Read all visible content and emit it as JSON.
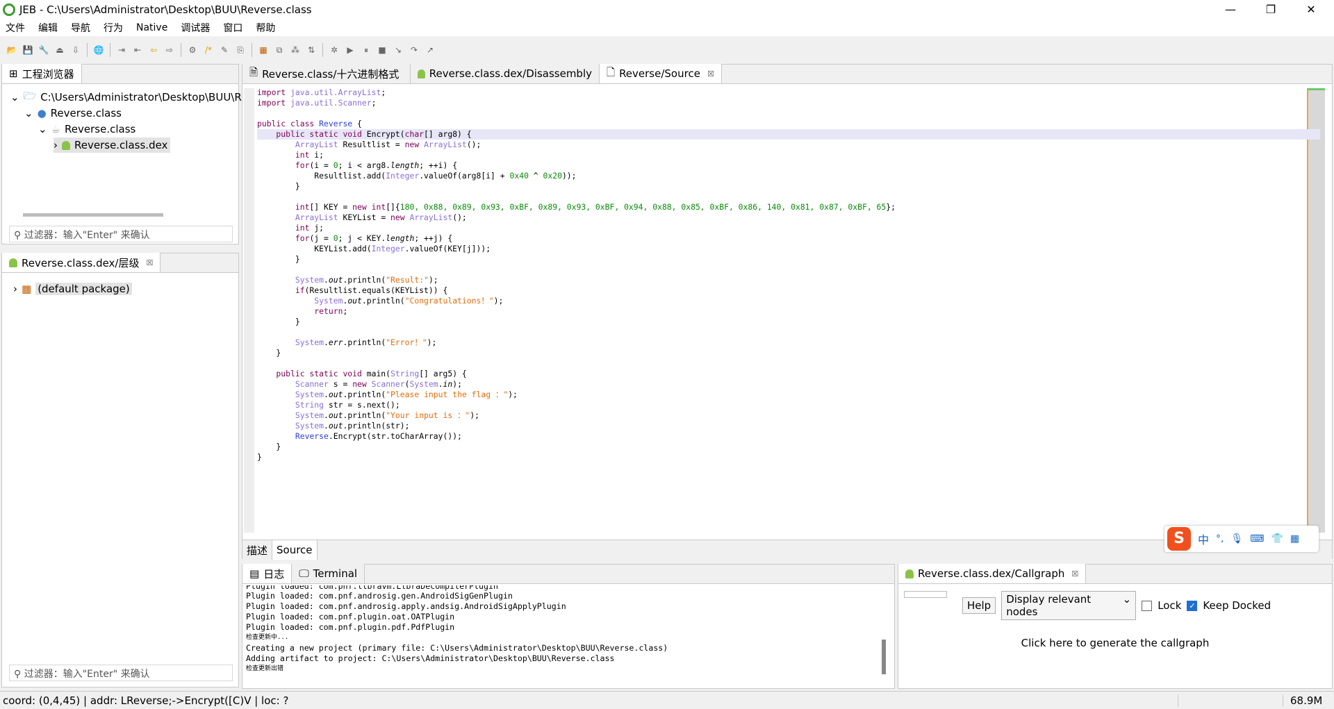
{
  "window": {
    "title": "JEB - C:\\Users\\Administrator\\Desktop\\BUU\\Reverse.class",
    "minimize": "—",
    "restore": "❐",
    "close": "✕"
  },
  "menu": [
    "文件",
    "编辑",
    "导航",
    "行为",
    "Native",
    "调试器",
    "窗口",
    "帮助"
  ],
  "project_explorer": {
    "tab": "工程浏览器",
    "items": [
      "C:\\Users\\Administrator\\Desktop\\BUU\\Reverse.class",
      "Reverse.class",
      "Reverse.class",
      "Reverse.class.dex"
    ],
    "filter_placeholder": "过滤器：输入\"Enter\" 来确认"
  },
  "hierarchy": {
    "tab": "Reverse.class.dex/层级",
    "items": [
      "(default package)"
    ],
    "filter_placeholder": "过滤器：输入\"Enter\" 来确认"
  },
  "editor": {
    "tabs": [
      "Reverse.class/十六进制格式",
      "Reverse.class.dex/Disassembly",
      "Reverse/Source"
    ],
    "bottom_tabs": [
      "描述",
      "Source"
    ],
    "code": [
      [
        [
          "import ",
          "kw"
        ],
        [
          "java.util.ArrayList",
          "ty"
        ],
        [
          ";",
          ""
        ]
      ],
      [
        [
          "import ",
          "kw"
        ],
        [
          "java.util.Scanner",
          "ty"
        ],
        [
          ";",
          ""
        ]
      ],
      [],
      [
        [
          "public class ",
          "kw"
        ],
        [
          "Reverse",
          "cls"
        ],
        [
          " {",
          ""
        ]
      ],
      [
        [
          "    public static void ",
          "kw"
        ],
        [
          "Encrypt(",
          ""
        ],
        [
          "char",
          "kw"
        ],
        [
          "[] arg8) {",
          ""
        ]
      ],
      [
        [
          "        ",
          ""
        ],
        [
          "ArrayList",
          "ty"
        ],
        [
          " Resultlist = ",
          ""
        ],
        [
          "new ",
          "kw"
        ],
        [
          "ArrayList",
          "ty"
        ],
        [
          "();",
          ""
        ]
      ],
      [
        [
          "        int ",
          "kw"
        ],
        [
          "i;",
          ""
        ]
      ],
      [
        [
          "        for",
          "kw"
        ],
        [
          "(i = ",
          ""
        ],
        [
          "0",
          "num"
        ],
        [
          "; i < arg8.",
          ""
        ],
        [
          "length",
          "it"
        ],
        [
          "; ++i) {",
          ""
        ]
      ],
      [
        [
          "            Resultlist.add(",
          ""
        ],
        [
          "Integer",
          "ty"
        ],
        [
          ".valueOf(arg8[i] + ",
          ""
        ],
        [
          "0x40",
          "num"
        ],
        [
          " ^ ",
          ""
        ],
        [
          "0x20",
          "num"
        ],
        [
          "));",
          ""
        ]
      ],
      [
        [
          "        }",
          ""
        ]
      ],
      [],
      [
        [
          "        int",
          "kw"
        ],
        [
          "[] KEY = ",
          ""
        ],
        [
          "new int",
          "kw"
        ],
        [
          "[]{",
          ""
        ],
        [
          "180, 0x88, 0x89, 0x93, 0xBF, 0x89, 0x93, 0xBF, 0x94, 0x88, 0x85, 0xBF, 0x86, 140, 0x81, 0x87, 0xBF, 65",
          "num"
        ],
        [
          "};",
          ""
        ]
      ],
      [
        [
          "        ",
          ""
        ],
        [
          "ArrayList",
          "ty"
        ],
        [
          " KEYList = ",
          ""
        ],
        [
          "new ",
          "kw"
        ],
        [
          "ArrayList",
          "ty"
        ],
        [
          "();",
          ""
        ]
      ],
      [
        [
          "        int ",
          "kw"
        ],
        [
          "j;",
          ""
        ]
      ],
      [
        [
          "        for",
          "kw"
        ],
        [
          "(j = ",
          ""
        ],
        [
          "0",
          "num"
        ],
        [
          "; j < KEY.",
          ""
        ],
        [
          "length",
          "it"
        ],
        [
          "; ++j) {",
          ""
        ]
      ],
      [
        [
          "            KEYList.add(",
          ""
        ],
        [
          "Integer",
          "ty"
        ],
        [
          ".valueOf(KEY[j]));",
          ""
        ]
      ],
      [
        [
          "        }",
          ""
        ]
      ],
      [],
      [
        [
          "        ",
          ""
        ],
        [
          "System",
          "ty"
        ],
        [
          ".",
          ""
        ],
        [
          "out",
          "it"
        ],
        [
          ".println(",
          ""
        ],
        [
          "\"Result:\"",
          "str"
        ],
        [
          ");",
          ""
        ]
      ],
      [
        [
          "        if",
          "kw"
        ],
        [
          "(Resultlist.equals(KEYList)) {",
          ""
        ]
      ],
      [
        [
          "            ",
          ""
        ],
        [
          "System",
          "ty"
        ],
        [
          ".",
          ""
        ],
        [
          "out",
          "it"
        ],
        [
          ".println(",
          ""
        ],
        [
          "\"Congratulations！\"",
          "str"
        ],
        [
          ");",
          ""
        ]
      ],
      [
        [
          "            return",
          "kw"
        ],
        [
          ";",
          ""
        ]
      ],
      [
        [
          "        }",
          ""
        ]
      ],
      [],
      [
        [
          "        ",
          ""
        ],
        [
          "System",
          "ty"
        ],
        [
          ".",
          ""
        ],
        [
          "err",
          "it"
        ],
        [
          ".println(",
          ""
        ],
        [
          "\"Error！\"",
          "str"
        ],
        [
          ");",
          ""
        ]
      ],
      [
        [
          "    }",
          ""
        ]
      ],
      [],
      [
        [
          "    public static void ",
          "kw"
        ],
        [
          "main(",
          ""
        ],
        [
          "String",
          "ty"
        ],
        [
          "[] arg5) {",
          ""
        ]
      ],
      [
        [
          "        ",
          ""
        ],
        [
          "Scanner",
          "ty"
        ],
        [
          " s = ",
          ""
        ],
        [
          "new ",
          "kw"
        ],
        [
          "Scanner",
          "ty"
        ],
        [
          "(",
          ""
        ],
        [
          "System",
          "ty"
        ],
        [
          ".",
          ""
        ],
        [
          "in",
          "it"
        ],
        [
          ");",
          ""
        ]
      ],
      [
        [
          "        ",
          ""
        ],
        [
          "System",
          "ty"
        ],
        [
          ".",
          ""
        ],
        [
          "out",
          "it"
        ],
        [
          ".println(",
          ""
        ],
        [
          "\"Please input the flag ：\"",
          "str"
        ],
        [
          ");",
          ""
        ]
      ],
      [
        [
          "        ",
          ""
        ],
        [
          "String",
          "ty"
        ],
        [
          " str = s.next();",
          ""
        ]
      ],
      [
        [
          "        ",
          ""
        ],
        [
          "System",
          "ty"
        ],
        [
          ".",
          ""
        ],
        [
          "out",
          "it"
        ],
        [
          ".println(",
          ""
        ],
        [
          "\"Your input is ：\"",
          "str"
        ],
        [
          ");",
          ""
        ]
      ],
      [
        [
          "        ",
          ""
        ],
        [
          "System",
          "ty"
        ],
        [
          ".",
          ""
        ],
        [
          "out",
          "it"
        ],
        [
          ".println(str);",
          ""
        ]
      ],
      [
        [
          "        ",
          ""
        ],
        [
          "Reverse",
          "cls"
        ],
        [
          ".Encrypt(str.toCharArray());",
          ""
        ]
      ],
      [
        [
          "    }",
          ""
        ]
      ],
      [
        [
          "}",
          ""
        ]
      ]
    ]
  },
  "log": {
    "tabs": [
      "日志",
      "Terminal"
    ],
    "lines": [
      "Plugin loaded: com.pnf.llbravm.LlbraDecompilerPlugin",
      "Plugin loaded: com.pnf.androsig.gen.AndroidSigGenPlugin",
      "Plugin loaded: com.pnf.androsig.apply.andsig.AndroidSigApplyPlugin",
      "Plugin loaded: com.pnf.plugin.oat.OATPlugin",
      "Plugin loaded: com.pnf.plugin.pdf.PdfPlugin",
      "检查更新中...",
      "Creating a new project (primary file: C:\\Users\\Administrator\\Desktop\\BUU\\Reverse.class)",
      "Adding artifact to project: C:\\Users\\Administrator\\Desktop\\BUU\\Reverse.class",
      "检查更新出错"
    ]
  },
  "callgraph": {
    "tab": "Reverse.class.dex/Callgraph",
    "help": "Help",
    "select": "Display relevant nodes",
    "lock": "Lock",
    "lock_checked": false,
    "keep_docked": "Keep Docked",
    "keep_docked_checked": true,
    "message": "Click here to generate the callgraph"
  },
  "ime": {
    "items": [
      "中",
      "°,",
      "🎤",
      "⌨",
      "👕",
      "▦"
    ]
  },
  "status": {
    "text": "coord: (0,4,45) | addr: LReverse;->Encrypt([C)V | loc: ?",
    "memory": "68.9M"
  },
  "colors": {
    "keyword": "#7f0055",
    "type": "#8a6fd6",
    "number": "#0a8a0a",
    "string": "#e36c0a",
    "highlight": "#e6e6f7"
  }
}
